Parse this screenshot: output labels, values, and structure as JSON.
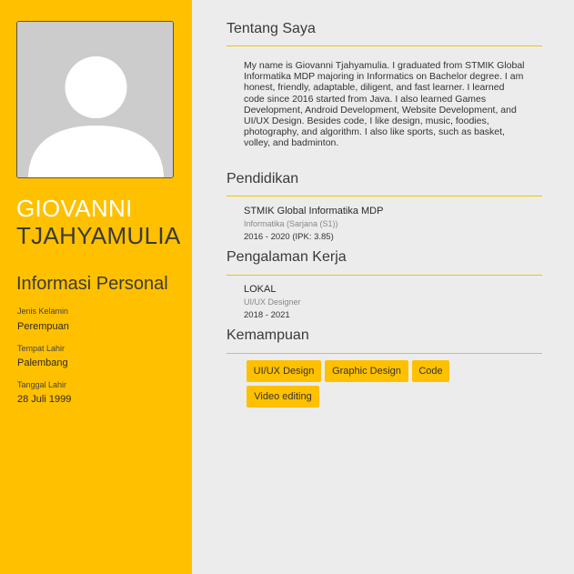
{
  "profile": {
    "first_name": "GIOVANNI",
    "last_name": "TJAHYAMULIA"
  },
  "personal": {
    "heading": "Informasi Personal",
    "gender_label": "Jenis Kelamin",
    "gender_value": "Perempuan",
    "birthplace_label": "Tempat Lahir",
    "birthplace_value": "Palembang",
    "birthdate_label": "Tanggal Lahir",
    "birthdate_value": "28 Juli 1999"
  },
  "about": {
    "heading": "Tentang Saya",
    "text": "My name is Giovanni Tjahyamulia. I graduated from STMIK Global Informatika MDP majoring in Informatics on Bachelor degree. I am honest, friendly, adaptable, diligent, and fast learner. I learned code since 2016 started from Java. I also learned Games Development, Android Development, Website Development, and UI/UX Design. Besides code, I like design, music, foodies, photography, and algorithm. I also like sports, such as basket, volley, and badminton."
  },
  "education": {
    "heading": "Pendidikan",
    "school": "STMIK Global Informatika MDP",
    "major": "Informatika (Sarjana (S1))",
    "period": "2016 - 2020 (IPK: 3.85)"
  },
  "experience": {
    "heading": "Pengalaman Kerja",
    "company": "LOKAL",
    "role": "UI/UX Designer",
    "period": "2018 - 2021"
  },
  "skills": {
    "heading": "Kemampuan",
    "items": [
      "UI/UX Design",
      "Graphic Design",
      "Code",
      "Video editing"
    ]
  },
  "colors": {
    "sidebar": "#ffc000",
    "page_bg": "#ececec",
    "rule": "#f2c400"
  }
}
